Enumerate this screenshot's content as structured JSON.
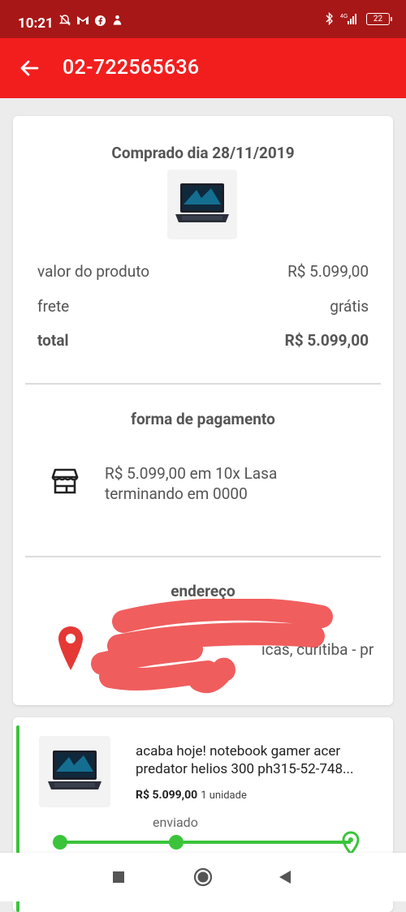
{
  "status_bar": {
    "time": "10:21",
    "network": "4G",
    "battery": "22"
  },
  "header": {
    "title": "02-722565636"
  },
  "order": {
    "purchase_date": "Comprado dia 28/11/2019",
    "rows": [
      {
        "label": "valor do produto",
        "value": "R$ 5.099,00"
      },
      {
        "label": "frete",
        "value": "grátis"
      },
      {
        "label": "total",
        "value": "R$ 5.099,00"
      }
    ]
  },
  "payment": {
    "title": "forma de pagamento",
    "line1": "R$ 5.099,00 em 10x Lasa",
    "line2": "terminando em 0000"
  },
  "address": {
    "title": "endereço",
    "text": "icas, curitiba - pr"
  },
  "item": {
    "title": "acaba hoje! notebook gamer acer predator helios 300 ph315-52-748...",
    "price": "R$ 5.099,00",
    "quantity": "1 unidade",
    "status": "enviado"
  },
  "colors": {
    "app_bar": "#f21e1e",
    "status_bar": "#a81717",
    "track_green": "#3bc43b",
    "pin_red": "#e53935"
  }
}
